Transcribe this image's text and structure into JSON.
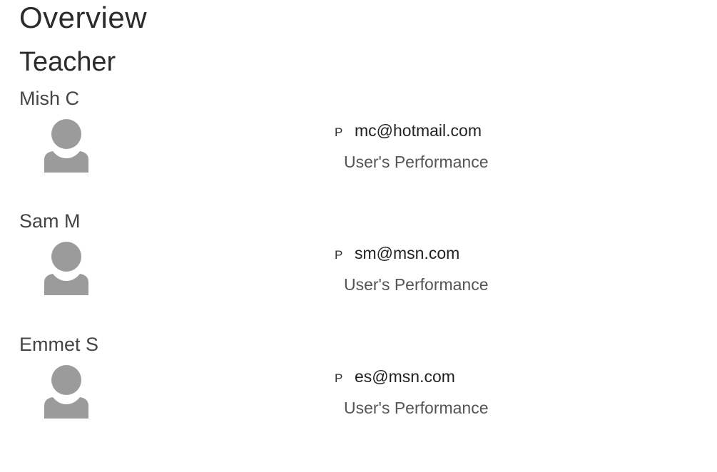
{
  "page": {
    "title": "Overview",
    "role": "Teacher"
  },
  "users": [
    {
      "name": "Mish C",
      "phone_icon_glyph": "P",
      "email": "mc@hotmail.com",
      "performance_label": "User's Performance"
    },
    {
      "name": "Sam M",
      "phone_icon_glyph": "P",
      "email": "sm@msn.com",
      "performance_label": "User's Performance"
    },
    {
      "name": "Emmet S",
      "phone_icon_glyph": "P",
      "email": "es@msn.com",
      "performance_label": "User's Performance"
    }
  ],
  "icons": {
    "avatar": "user-avatar-icon",
    "phone": "phone-icon"
  },
  "colors": {
    "avatar_fill": "#9b9b9b",
    "text_dark": "#2b2b2b",
    "text_muted": "#555555"
  }
}
